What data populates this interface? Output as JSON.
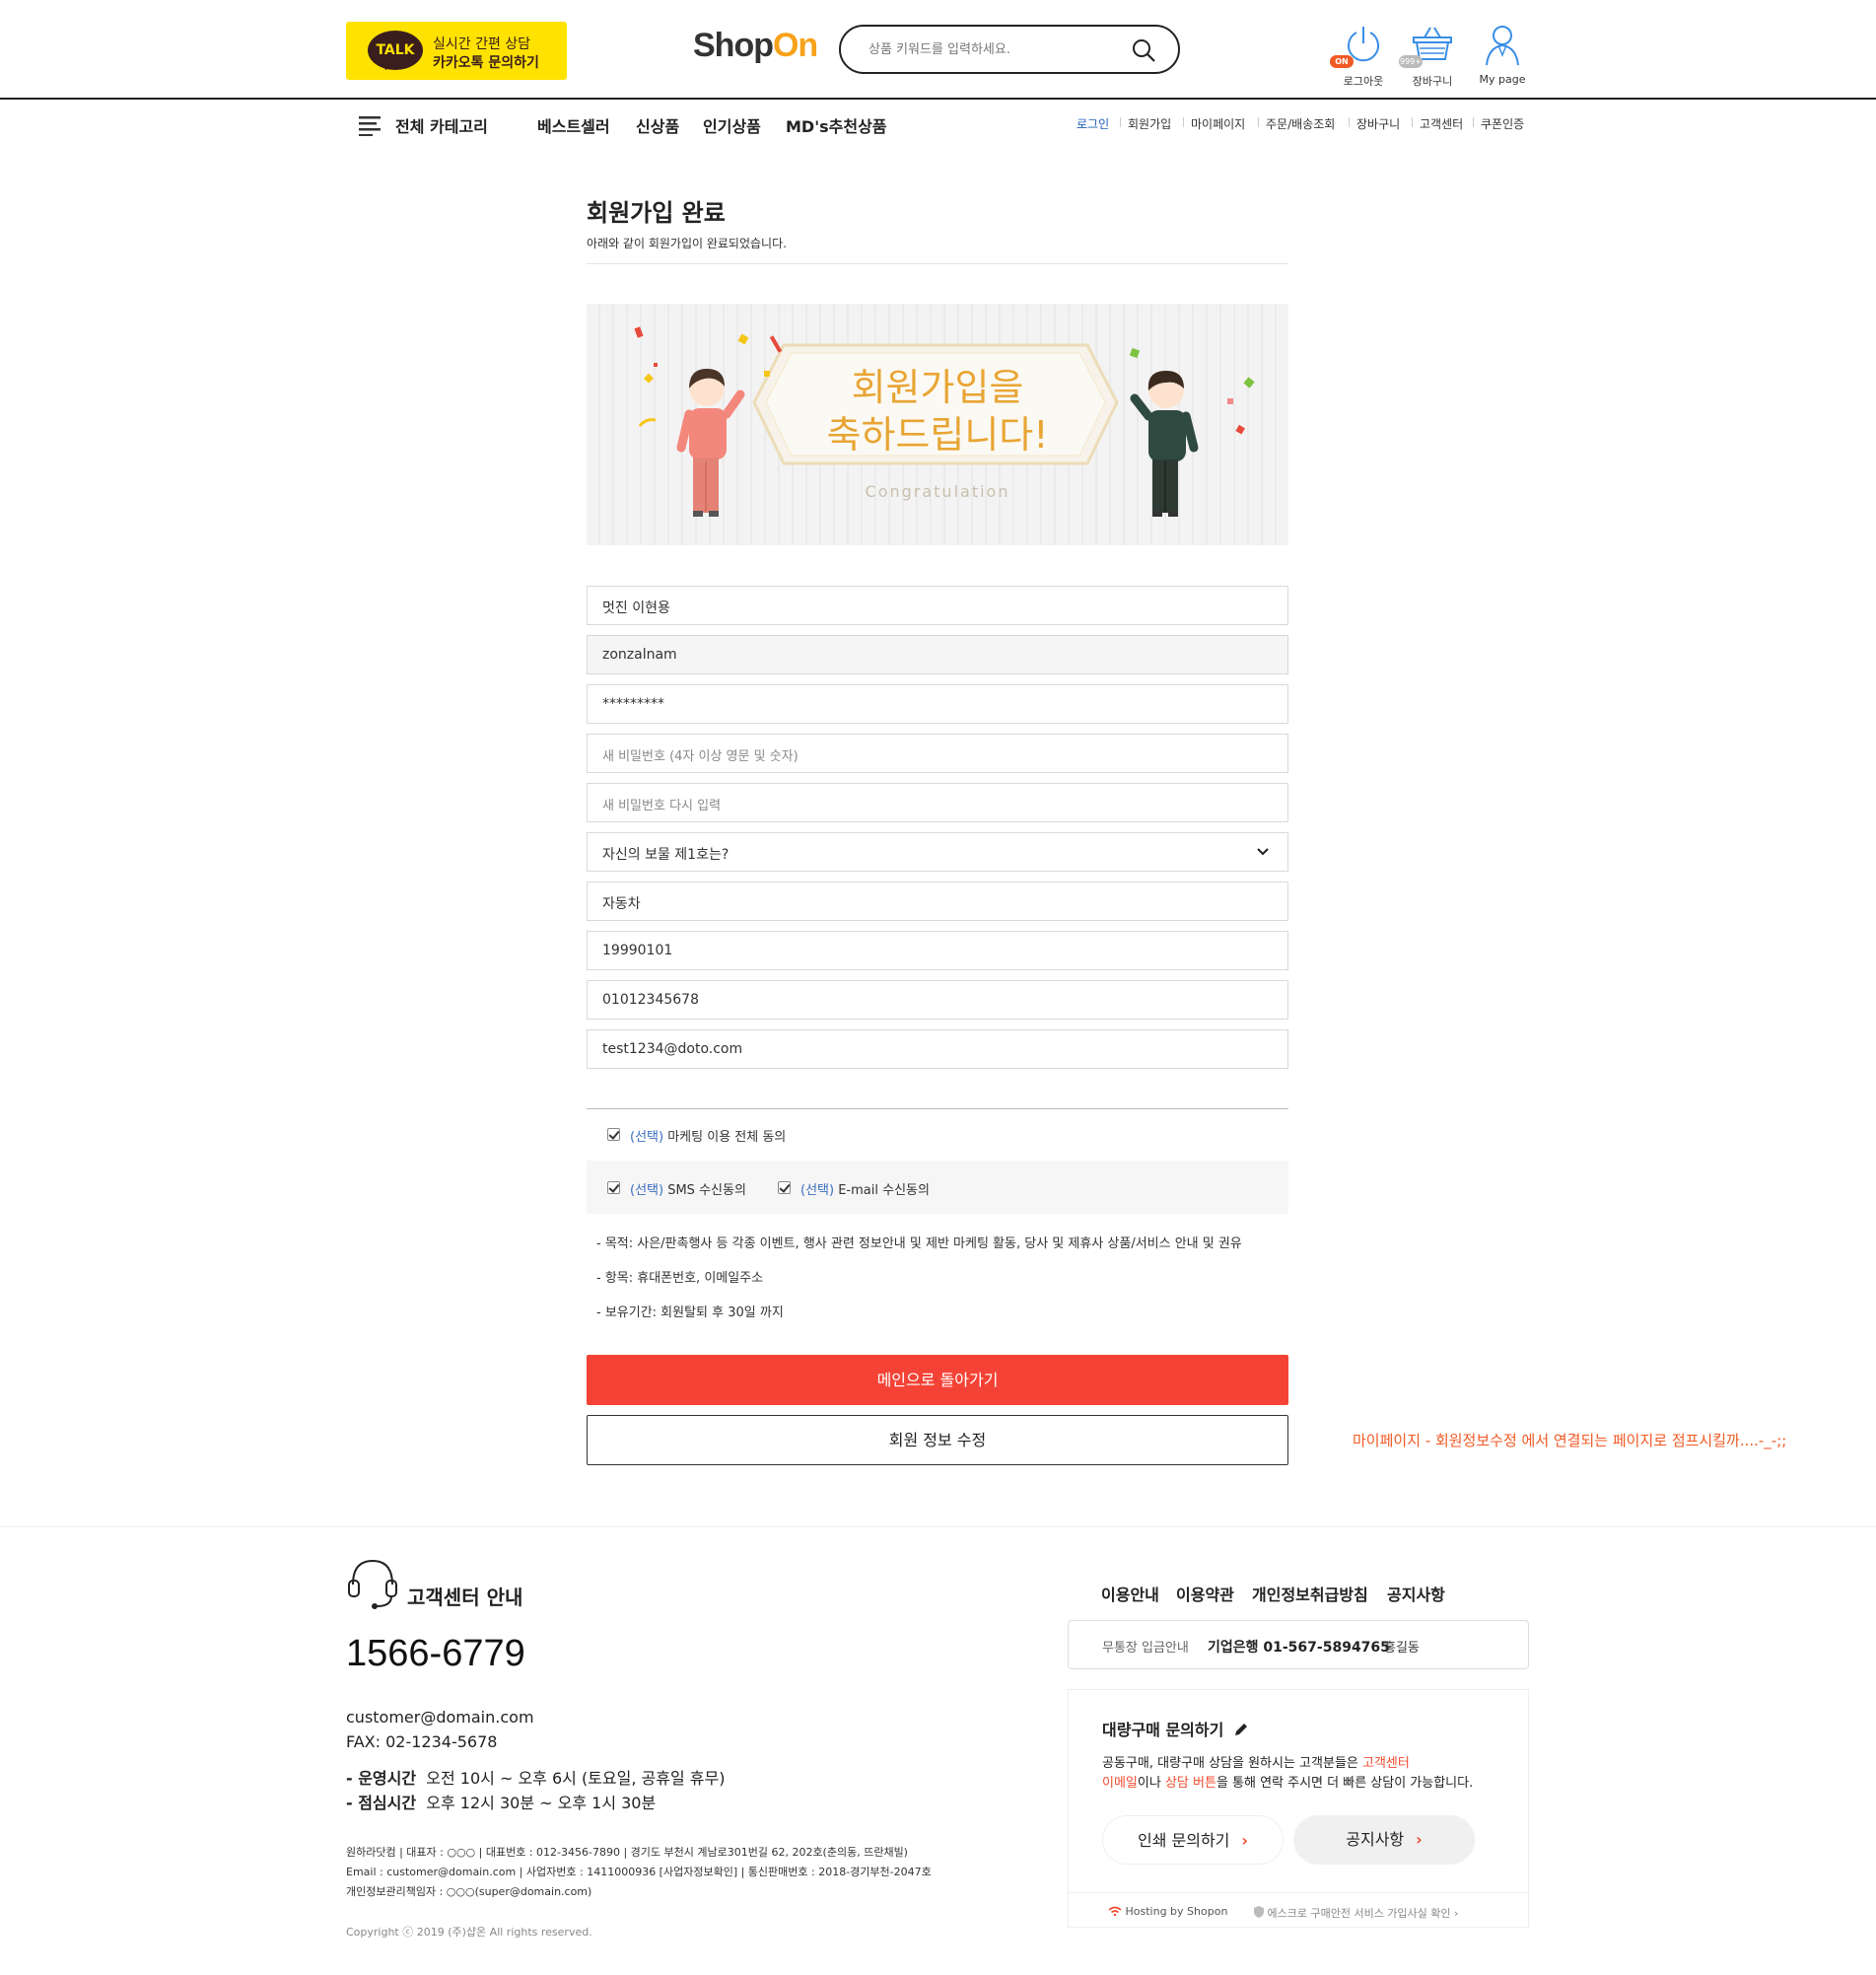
{
  "header": {
    "talk_badge": "TALK",
    "talk_line1": "실시간 간편 상담",
    "talk_line2": "카카오톡 문의하기",
    "logo_shop": "Shop",
    "logo_on": "On",
    "search_placeholder": "상품 키워드를 입력하세요.",
    "icons": [
      {
        "label": "로그아웃",
        "icon": "power-icon",
        "badge": "ON"
      },
      {
        "label": "장바구니",
        "icon": "basket-icon",
        "badge": "999+"
      },
      {
        "label": "My page",
        "icon": "user-icon"
      }
    ]
  },
  "nav": {
    "all_category": "전체 카테고리",
    "main": [
      "베스트셀러",
      "신상품",
      "인기상품",
      "MD's추천상품"
    ],
    "util": [
      "로그인",
      "회원가입",
      "마이페이지",
      "주문/배송조회",
      "장바구니",
      "고객센터",
      "쿠폰인증"
    ]
  },
  "content": {
    "title": "회원가입 완료",
    "subtitle": "아래와 같이 회원가입이 완료되었습니다.",
    "banner_line1": "회원가입을",
    "banner_line2": "축하드립니다!",
    "banner_en": "Congratulation",
    "fields": {
      "name": "멋진 이현용",
      "userid": "zonzalnam",
      "password": "*********",
      "new_pw_placeholder": "새 비밀번호 (4자 이상 영문 및 숫자)",
      "new_pw2_placeholder": "새 비밀번호 다시 입력",
      "question": "자신의 보물 제1호는?",
      "answer": "자동차",
      "birth": "19990101",
      "phone": "01012345678",
      "email": "test1234@doto.com"
    },
    "agree": {
      "opt": "(선택)",
      "all": "마케팅 이용 전체 동의",
      "sms": "SMS 수신동의",
      "email": "E-mail 수신동의"
    },
    "notes": [
      "- 목적: 사은/판촉행사 등 각종 이벤트, 행사 관련 정보안내 및 제반 마케팅 활동, 당사 및 제휴사 상품/서비스 안내 및 권유",
      "- 항목: 휴대폰번호, 이메일주소",
      "- 보유기간: 회원탈퇴 후 30일 까지"
    ],
    "btn_main": "메인으로 돌아가기",
    "btn_edit": "회원 정보 수정",
    "dev_note": "마이페이지 - 회원정보수정 에서 연결되는 페이지로 점프시킬까....-_-;;"
  },
  "footer": {
    "cs_title": "고객센터 안내",
    "phone": "1566-6779",
    "email": "customer@domain.com",
    "fax": "FAX: 02-1234-5678",
    "hours_label": "- 운영시간",
    "hours": "오전 10시 ~ 오후 6시 (토요일, 공휴일 휴무)",
    "lunch_label": "- 점심시간",
    "lunch": "오후 12시 30분 ~ 오후 1시 30분",
    "corp_line1": "원하라닷컴  |  대표자 : ○○○  |  대표번호 : 012-3456-7890  |  경기도 부천시 계남로301번길 62, 202호(춘의동, 뜨란채빌)",
    "corp_line2": "Email : customer@domain.com  |  사업자번호 : 1411000936 [사업자정보확인]  |  통신판매번호 : 2018-경기부천-2047호",
    "corp_line3": "개인정보관리책임자 : ○○○(super@domain.com)",
    "copyright": "Copyright ⓒ 2019 (주)샵온 All rights reserved.",
    "links": [
      "이용안내",
      "이용약관",
      "개인정보취급방침",
      "공지사항"
    ],
    "bank_label": "무통장 입금안내",
    "bank_val": "기업은행 01-567-5894765",
    "bank_name": "홍길동",
    "bulk_title": "대량구매 문의하기",
    "bulk_desc_1a": "공동구매, 대량구매 상담을 원하시는 고객분들은 ",
    "bulk_desc_1b": "고객센터",
    "bulk_desc_2a": "이메일",
    "bulk_desc_2b": "이나 ",
    "bulk_desc_2c": "상담 버튼",
    "bulk_desc_2d": "을 통해 연락 주시면 더 빠른 상담이 가능합니다.",
    "btn_inquiry": "인쇄 문의하기",
    "btn_notice": "공지사항",
    "hosting": "Hosting by Shopon",
    "escrow": "에스크로 구매안전 서비스 가입사실 확인"
  },
  "colors": {
    "accent_red": "#f44336",
    "kakao_yellow": "#ffe200",
    "logo_orange": "#f7a21b",
    "link_blue": "#1e5fb8"
  }
}
